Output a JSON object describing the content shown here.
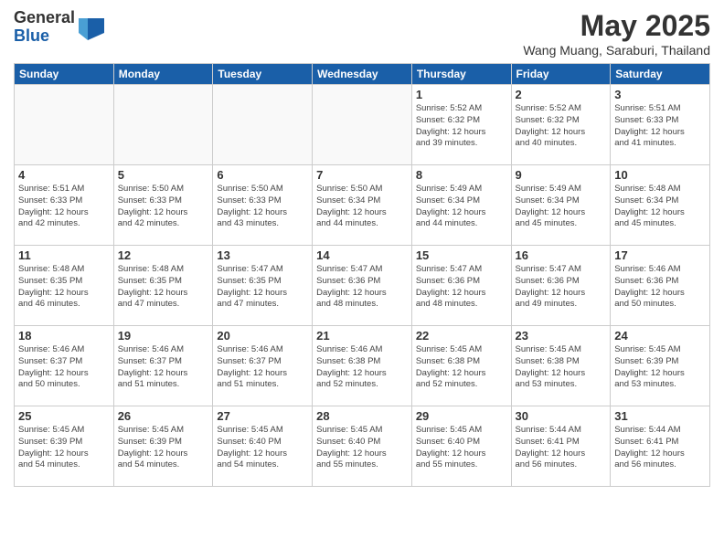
{
  "logo": {
    "general": "General",
    "blue": "Blue"
  },
  "title": "May 2025",
  "location": "Wang Muang, Saraburi, Thailand",
  "days_header": [
    "Sunday",
    "Monday",
    "Tuesday",
    "Wednesday",
    "Thursday",
    "Friday",
    "Saturday"
  ],
  "weeks": [
    [
      {
        "day": "",
        "info": ""
      },
      {
        "day": "",
        "info": ""
      },
      {
        "day": "",
        "info": ""
      },
      {
        "day": "",
        "info": ""
      },
      {
        "day": "1",
        "info": "Sunrise: 5:52 AM\nSunset: 6:32 PM\nDaylight: 12 hours\nand 39 minutes."
      },
      {
        "day": "2",
        "info": "Sunrise: 5:52 AM\nSunset: 6:32 PM\nDaylight: 12 hours\nand 40 minutes."
      },
      {
        "day": "3",
        "info": "Sunrise: 5:51 AM\nSunset: 6:33 PM\nDaylight: 12 hours\nand 41 minutes."
      }
    ],
    [
      {
        "day": "4",
        "info": "Sunrise: 5:51 AM\nSunset: 6:33 PM\nDaylight: 12 hours\nand 42 minutes."
      },
      {
        "day": "5",
        "info": "Sunrise: 5:50 AM\nSunset: 6:33 PM\nDaylight: 12 hours\nand 42 minutes."
      },
      {
        "day": "6",
        "info": "Sunrise: 5:50 AM\nSunset: 6:33 PM\nDaylight: 12 hours\nand 43 minutes."
      },
      {
        "day": "7",
        "info": "Sunrise: 5:50 AM\nSunset: 6:34 PM\nDaylight: 12 hours\nand 44 minutes."
      },
      {
        "day": "8",
        "info": "Sunrise: 5:49 AM\nSunset: 6:34 PM\nDaylight: 12 hours\nand 44 minutes."
      },
      {
        "day": "9",
        "info": "Sunrise: 5:49 AM\nSunset: 6:34 PM\nDaylight: 12 hours\nand 45 minutes."
      },
      {
        "day": "10",
        "info": "Sunrise: 5:48 AM\nSunset: 6:34 PM\nDaylight: 12 hours\nand 45 minutes."
      }
    ],
    [
      {
        "day": "11",
        "info": "Sunrise: 5:48 AM\nSunset: 6:35 PM\nDaylight: 12 hours\nand 46 minutes."
      },
      {
        "day": "12",
        "info": "Sunrise: 5:48 AM\nSunset: 6:35 PM\nDaylight: 12 hours\nand 47 minutes."
      },
      {
        "day": "13",
        "info": "Sunrise: 5:47 AM\nSunset: 6:35 PM\nDaylight: 12 hours\nand 47 minutes."
      },
      {
        "day": "14",
        "info": "Sunrise: 5:47 AM\nSunset: 6:36 PM\nDaylight: 12 hours\nand 48 minutes."
      },
      {
        "day": "15",
        "info": "Sunrise: 5:47 AM\nSunset: 6:36 PM\nDaylight: 12 hours\nand 48 minutes."
      },
      {
        "day": "16",
        "info": "Sunrise: 5:47 AM\nSunset: 6:36 PM\nDaylight: 12 hours\nand 49 minutes."
      },
      {
        "day": "17",
        "info": "Sunrise: 5:46 AM\nSunset: 6:36 PM\nDaylight: 12 hours\nand 50 minutes."
      }
    ],
    [
      {
        "day": "18",
        "info": "Sunrise: 5:46 AM\nSunset: 6:37 PM\nDaylight: 12 hours\nand 50 minutes."
      },
      {
        "day": "19",
        "info": "Sunrise: 5:46 AM\nSunset: 6:37 PM\nDaylight: 12 hours\nand 51 minutes."
      },
      {
        "day": "20",
        "info": "Sunrise: 5:46 AM\nSunset: 6:37 PM\nDaylight: 12 hours\nand 51 minutes."
      },
      {
        "day": "21",
        "info": "Sunrise: 5:46 AM\nSunset: 6:38 PM\nDaylight: 12 hours\nand 52 minutes."
      },
      {
        "day": "22",
        "info": "Sunrise: 5:45 AM\nSunset: 6:38 PM\nDaylight: 12 hours\nand 52 minutes."
      },
      {
        "day": "23",
        "info": "Sunrise: 5:45 AM\nSunset: 6:38 PM\nDaylight: 12 hours\nand 53 minutes."
      },
      {
        "day": "24",
        "info": "Sunrise: 5:45 AM\nSunset: 6:39 PM\nDaylight: 12 hours\nand 53 minutes."
      }
    ],
    [
      {
        "day": "25",
        "info": "Sunrise: 5:45 AM\nSunset: 6:39 PM\nDaylight: 12 hours\nand 54 minutes."
      },
      {
        "day": "26",
        "info": "Sunrise: 5:45 AM\nSunset: 6:39 PM\nDaylight: 12 hours\nand 54 minutes."
      },
      {
        "day": "27",
        "info": "Sunrise: 5:45 AM\nSunset: 6:40 PM\nDaylight: 12 hours\nand 54 minutes."
      },
      {
        "day": "28",
        "info": "Sunrise: 5:45 AM\nSunset: 6:40 PM\nDaylight: 12 hours\nand 55 minutes."
      },
      {
        "day": "29",
        "info": "Sunrise: 5:45 AM\nSunset: 6:40 PM\nDaylight: 12 hours\nand 55 minutes."
      },
      {
        "day": "30",
        "info": "Sunrise: 5:44 AM\nSunset: 6:41 PM\nDaylight: 12 hours\nand 56 minutes."
      },
      {
        "day": "31",
        "info": "Sunrise: 5:44 AM\nSunset: 6:41 PM\nDaylight: 12 hours\nand 56 minutes."
      }
    ]
  ]
}
